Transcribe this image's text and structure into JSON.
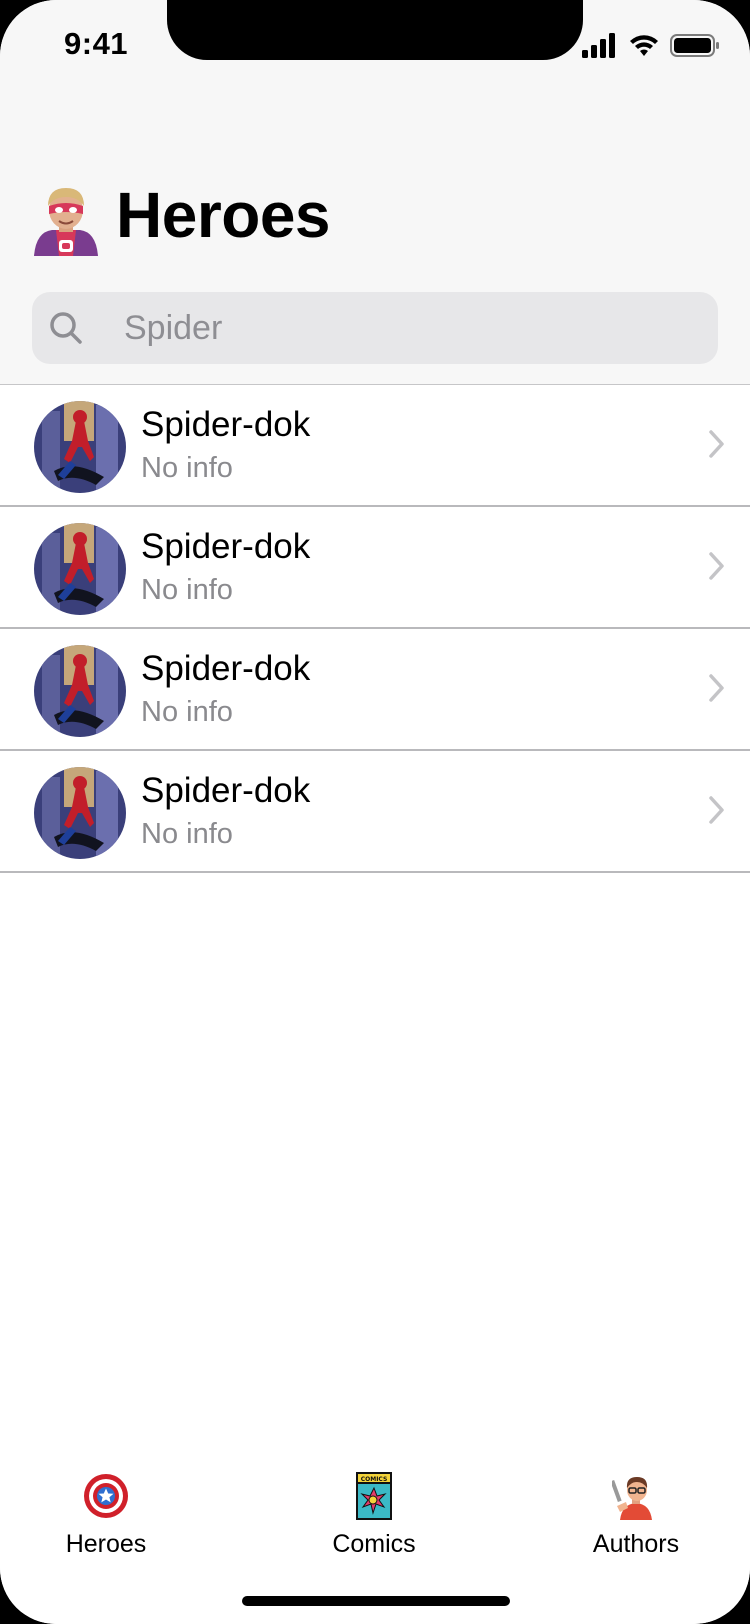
{
  "status_bar": {
    "time": "9:41"
  },
  "header": {
    "emoji": "superhero-emoji-icon",
    "title": "Heroes"
  },
  "search": {
    "value": "",
    "placeholder": "Spider"
  },
  "heroes": [
    {
      "name": "Spider-dok",
      "info": "No info",
      "avatar": "spider-hero-avatar"
    },
    {
      "name": "Spider-dok",
      "info": "No info",
      "avatar": "spider-hero-avatar"
    },
    {
      "name": "Spider-dok",
      "info": "No info",
      "avatar": "spider-hero-avatar"
    },
    {
      "name": "Spider-dok",
      "info": "No info",
      "avatar": "spider-hero-avatar"
    }
  ],
  "tab_bar": {
    "tabs": [
      {
        "label": "Heroes",
        "icon": "shield-icon"
      },
      {
        "label": "Comics",
        "icon": "comic-book-icon"
      },
      {
        "label": "Authors",
        "icon": "author-icon"
      }
    ]
  },
  "colors": {
    "background_header": "#f7f7f7",
    "search_field": "#e7e7e9",
    "secondary_text": "#8a8a8e",
    "separator": "#b9b9bc",
    "shield_red": "#d0202a",
    "shield_blue": "#2f6fd0"
  }
}
